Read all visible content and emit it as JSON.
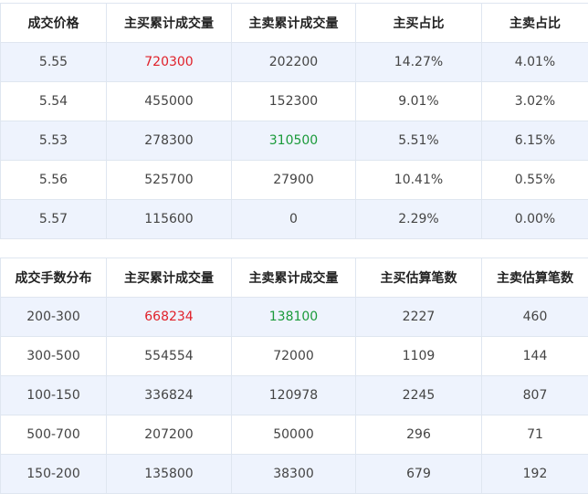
{
  "price_table": {
    "headers": [
      "成交价格",
      "主买累计成交量",
      "主卖累计成交量",
      "主买占比",
      "主卖占比"
    ],
    "rows": [
      [
        "5.55",
        "720300",
        "202200",
        "14.27%",
        "4.01%"
      ],
      [
        "5.54",
        "455000",
        "152300",
        "9.01%",
        "3.02%"
      ],
      [
        "5.53",
        "278300",
        "310500",
        "5.51%",
        "6.15%"
      ],
      [
        "5.56",
        "525700",
        "27900",
        "10.41%",
        "0.55%"
      ],
      [
        "5.57",
        "115600",
        "0",
        "2.29%",
        "0.00%"
      ]
    ]
  },
  "volume_table": {
    "headers": [
      "成交手数分布",
      "主买累计成交量",
      "主卖累计成交量",
      "主买估算笔数",
      "主卖估算笔数"
    ],
    "rows": [
      [
        "200-300",
        "668234",
        "138100",
        "2227",
        "460"
      ],
      [
        "300-500",
        "554554",
        "72000",
        "1109",
        "144"
      ],
      [
        "100-150",
        "336824",
        "120978",
        "2245",
        "807"
      ],
      [
        "500-700",
        "207200",
        "50000",
        "296",
        "71"
      ],
      [
        "150-200",
        "135800",
        "38300",
        "679",
        "192"
      ]
    ]
  },
  "colors": {
    "highlight_red": "#e0212a",
    "highlight_green": "#1a9a3a",
    "row_stripe": "#eef3fd",
    "border": "#dfe6f0"
  }
}
